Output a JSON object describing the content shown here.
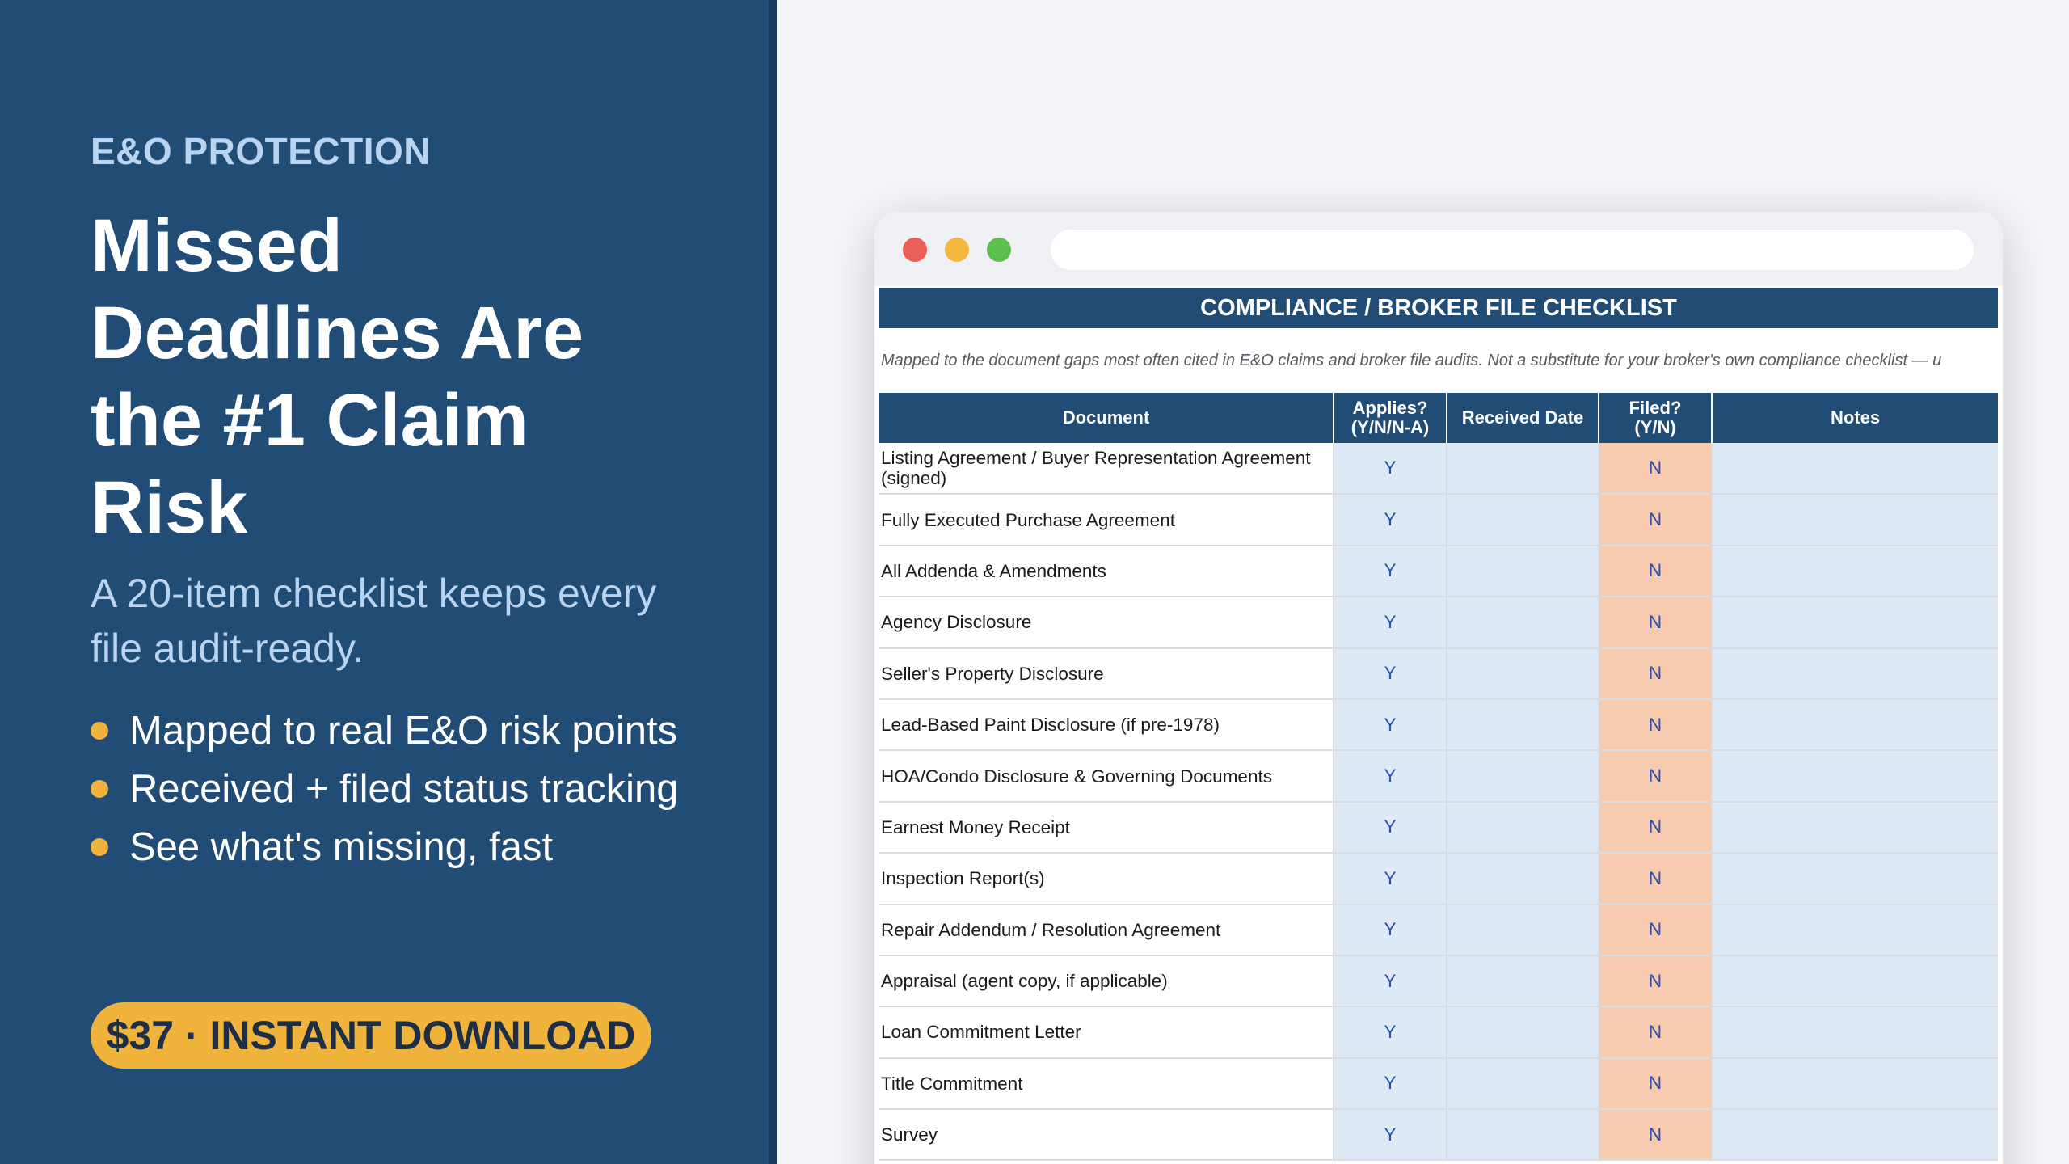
{
  "promo": {
    "eyebrow": "E&O PROTECTION",
    "headline": "Missed Deadlines Are the #1 Claim Risk",
    "subhead": "A 20-item checklist keeps every file audit-ready.",
    "bullets": [
      "Mapped to real E&O risk points",
      "Received + filed status tracking",
      "See what's missing, fast"
    ],
    "cta": "$37 · INSTANT DOWNLOAD"
  },
  "colors": {
    "navy": "#204c76",
    "accent_gold": "#f0b43c",
    "cell_blue": "#dde9f5",
    "cell_peach": "#f6cbb0"
  },
  "sheet": {
    "title": "COMPLIANCE / BROKER FILE CHECKLIST",
    "note": "Mapped to the document gaps most often cited in E&O claims and broker file audits. Not a substitute for your broker's own compliance checklist — u",
    "headers": {
      "document": "Document",
      "applies_line1": "Applies?",
      "applies_line2": "(Y/N/N-A)",
      "received": "Received Date",
      "filed_line1": "Filed?",
      "filed_line2": "(Y/N)",
      "notes": "Notes"
    },
    "rows": [
      {
        "document": "Listing Agreement / Buyer Representation Agreement (signed)",
        "applies": "Y",
        "received": "",
        "filed": "N",
        "notes": ""
      },
      {
        "document": "Fully Executed Purchase Agreement",
        "applies": "Y",
        "received": "",
        "filed": "N",
        "notes": ""
      },
      {
        "document": "All Addenda & Amendments",
        "applies": "Y",
        "received": "",
        "filed": "N",
        "notes": ""
      },
      {
        "document": "Agency Disclosure",
        "applies": "Y",
        "received": "",
        "filed": "N",
        "notes": ""
      },
      {
        "document": "Seller's Property Disclosure",
        "applies": "Y",
        "received": "",
        "filed": "N",
        "notes": ""
      },
      {
        "document": "Lead-Based Paint Disclosure (if pre-1978)",
        "applies": "Y",
        "received": "",
        "filed": "N",
        "notes": ""
      },
      {
        "document": "HOA/Condo Disclosure & Governing Documents",
        "applies": "Y",
        "received": "",
        "filed": "N",
        "notes": ""
      },
      {
        "document": "Earnest Money Receipt",
        "applies": "Y",
        "received": "",
        "filed": "N",
        "notes": ""
      },
      {
        "document": "Inspection Report(s)",
        "applies": "Y",
        "received": "",
        "filed": "N",
        "notes": ""
      },
      {
        "document": "Repair Addendum / Resolution Agreement",
        "applies": "Y",
        "received": "",
        "filed": "N",
        "notes": ""
      },
      {
        "document": "Appraisal (agent copy, if applicable)",
        "applies": "Y",
        "received": "",
        "filed": "N",
        "notes": ""
      },
      {
        "document": "Loan Commitment Letter",
        "applies": "Y",
        "received": "",
        "filed": "N",
        "notes": ""
      },
      {
        "document": "Title Commitment",
        "applies": "Y",
        "received": "",
        "filed": "N",
        "notes": ""
      },
      {
        "document": "Survey",
        "applies": "Y",
        "received": "",
        "filed": "N",
        "notes": ""
      }
    ]
  }
}
